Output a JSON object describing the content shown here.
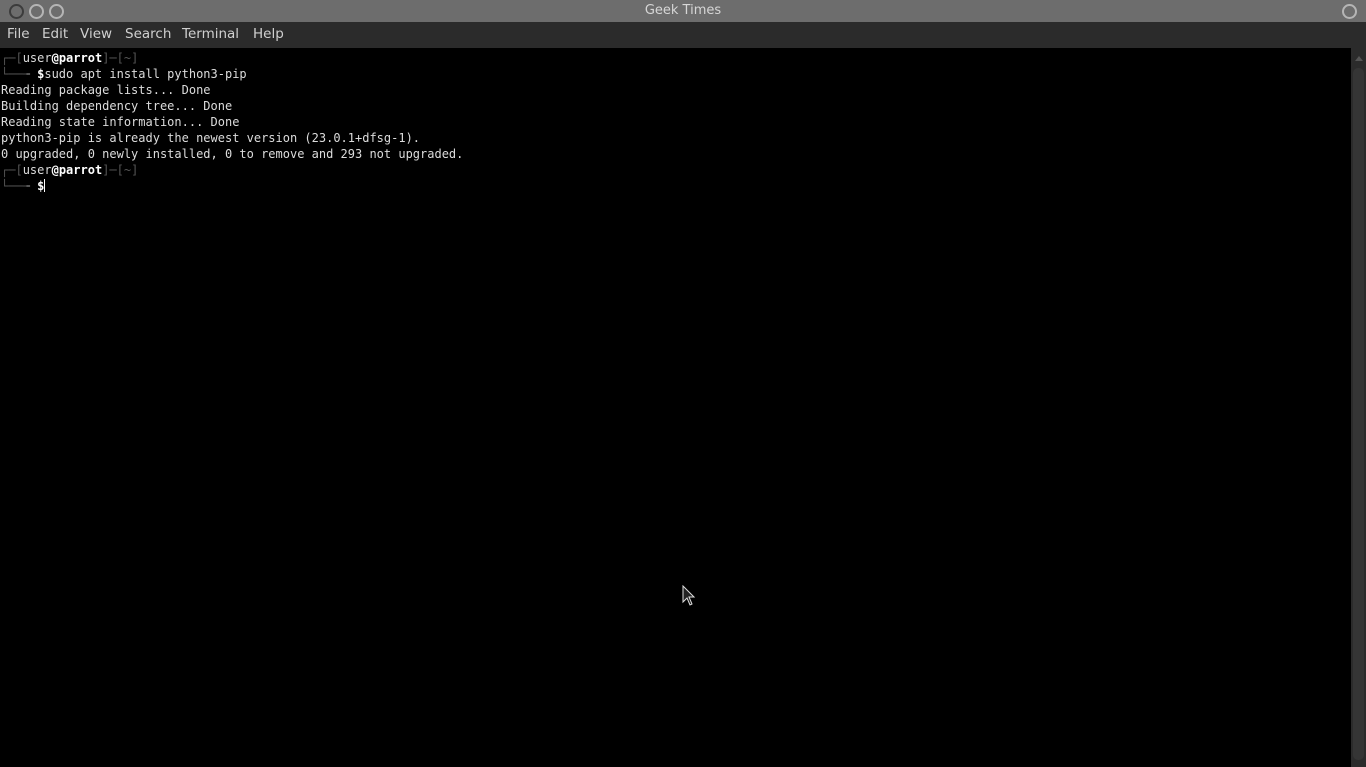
{
  "window": {
    "title": "Geek Times"
  },
  "menu": [
    "File",
    "Edit",
    "View",
    "Search",
    "Terminal",
    "Help"
  ],
  "terminal": {
    "prompt1": {
      "user": "user",
      "at": "@",
      "host": "parrot",
      "dir": "~",
      "symbol": "$",
      "command": "sudo apt install python3-pip"
    },
    "output": [
      "Reading package lists... Done",
      "Building dependency tree... Done",
      "Reading state information... Done",
      "python3-pip is already the newest version (23.0.1+dfsg-1).",
      "0 upgraded, 0 newly installed, 0 to remove and 293 not upgraded."
    ],
    "prompt2": {
      "user": "user",
      "at": "@",
      "host": "parrot",
      "dir": "~",
      "symbol": "$",
      "command": ""
    }
  }
}
